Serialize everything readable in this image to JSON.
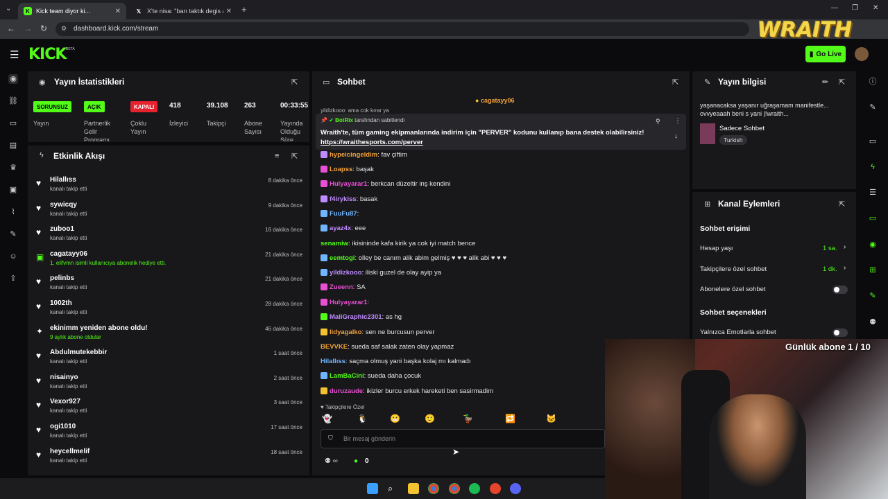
{
  "browser": {
    "tabs": [
      {
        "title": "Kick team diyor ki...",
        "active": true
      },
      {
        "title": "X'te nisa: \"barı taktık degis amk...",
        "active": false
      }
    ],
    "url": "dashboard.kick.com/stream"
  },
  "header": {
    "logo": "KICK",
    "beta": "BETA",
    "go_live": "Go Live",
    "overlay_logo": "WRAITH"
  },
  "stats": {
    "title": "Yayın İstatistikleri",
    "badges": [
      {
        "label": "SORUNSUZ",
        "caption": "Yayın",
        "color": "#53fc18"
      },
      {
        "label": "AÇIK",
        "caption": "Partnerlik Gelir Programı",
        "color": "#53fc18"
      },
      {
        "label": "KAPALI",
        "caption": "Çoklu Yayın",
        "color": "#e5222d"
      }
    ],
    "values": [
      {
        "value": "418",
        "caption": "İzleyici"
      },
      {
        "value": "39.108",
        "caption": "Takipçi"
      },
      {
        "value": "263",
        "caption": "Abone Sayısı"
      },
      {
        "value": "00:33:55",
        "caption": "Yayında Olduğu Süre"
      }
    ]
  },
  "activity": {
    "title": "Etkinlik Akışı",
    "items": [
      {
        "name": "Hilallıss",
        "sub": "kanalı takip etti",
        "time": "8 dakika önce"
      },
      {
        "name": "sywicqy",
        "sub": "kanalı takip etti",
        "time": "9 dakika önce"
      },
      {
        "name": "zuboo1",
        "sub": "kanalı takip etti",
        "time": "16 dakika önce"
      },
      {
        "name": "cagatayy06",
        "sub": "1, elifvmn isimli kullanıcıya abonelik hediye etti.",
        "time": "21 dakika önce"
      },
      {
        "name": "pelinbs",
        "sub": "kanalı takip etti",
        "time": "21 dakika önce"
      },
      {
        "name": "1002th",
        "sub": "kanalı takip etti",
        "time": "28 dakika önce"
      },
      {
        "name": "ekinimm yeniden abone oldu!",
        "sub": "9 aylık abone oldular",
        "time": "46 dakika önce"
      },
      {
        "name": "Abdulmutekebbir",
        "sub": "kanalı takip etti",
        "time": "1 saat önce"
      },
      {
        "name": "nisainyo",
        "sub": "kanalı takip etti",
        "time": "2 saat önce"
      },
      {
        "name": "Vexor927",
        "sub": "kanalı takip etti",
        "time": "3 saat önce"
      },
      {
        "name": "ogi1010",
        "sub": "kanalı takip etti",
        "time": "17 saat önce"
      },
      {
        "name": "heycellmelif",
        "sub": "kanalı takip etti",
        "time": "18 saat önce"
      }
    ]
  },
  "chat": {
    "title": "Sohbet",
    "top_user": "cagatayy06",
    "partial_line": "yildizkooo: ama cok kırar ya",
    "pinned": {
      "by": "BotRix",
      "by_suffix": "tarafından sabitlendi",
      "text": "Wraith'te, tüm gaming ekipmanlarında indirim için \"PERVER\" kodunu kullanıp bana destek olabilirsiniz!",
      "link": "https://wraithesports.com/perver"
    },
    "messages": [
      {
        "user": "hypeicingeldim",
        "color": "#f2a13a",
        "text": "fav çiftim"
      },
      {
        "user": "Loapss",
        "color": "#f2a13a",
        "text": "başak"
      },
      {
        "user": "Hulyayarar1",
        "color": "#e84fd1",
        "text": "berkcan düzeltir inş kendini"
      },
      {
        "user": "f4irykiss",
        "color": "#c08bff",
        "text": "basak"
      },
      {
        "user": "FuuFu87",
        "color": "#6fb6ff",
        "text": ""
      },
      {
        "user": "ayaz4x",
        "color": "#c08bff",
        "text": "eee"
      },
      {
        "user": "senamiw",
        "color": "#53fc18",
        "text": "ikisininde kafa kirik ya cok iyi match bence"
      },
      {
        "user": "eemtogi",
        "color": "#53fc18",
        "text": "olley be canım alik abim gelmiş ♥ ♥ ♥ alik abi ♥ ♥ ♥"
      },
      {
        "user": "yildizkooo",
        "color": "#c08bff",
        "text": "iliski guzel de olay ayip ya"
      },
      {
        "user": "Zueenn",
        "color": "#e84fd1",
        "text": "SA"
      },
      {
        "user": "Hulyayarar1",
        "color": "#e84fd1",
        "text": ""
      },
      {
        "user": "MaliGraphic2301",
        "color": "#c08bff",
        "text": "as hg"
      },
      {
        "user": "lidyagalko",
        "color": "#f2a13a",
        "text": "sen ne burcusun perver"
      },
      {
        "user": "BEVVKE",
        "color": "#f2a13a",
        "text": "sueda saf salak zaten olay yapmaz"
      },
      {
        "user": "Hilallıss",
        "color": "#6fb6ff",
        "text": "saçma olmuş yani başka kolaj mı kalmadı"
      },
      {
        "user": "LamBaCini",
        "color": "#53fc18",
        "text": "sueda daha çocuk"
      },
      {
        "user": "duruzaude",
        "color": "#e84fd1",
        "text": "ikizler burcu erkek hareketi ben sasirmadim"
      }
    ],
    "followers_only": "Takipçilere Özel",
    "input_placeholder": "Bir mesaj gönderin",
    "bottom_count": "0"
  },
  "stream_info": {
    "title": "Yayın bilgisi",
    "description": "yaşanacaksa yaşanır uğraşamam manifestle... ovvyeaaah beni s yani |!wraith...",
    "category": "Sadece Sohbet",
    "language": "Turkish"
  },
  "channel_actions": {
    "title": "Kanal Eylemleri",
    "chat_access": "Sohbet erişimi",
    "rows": [
      {
        "label": "Hesap yaşı",
        "value": "1 sa."
      },
      {
        "label": "Takipçilere özel sohbet",
        "value": "1 dk."
      },
      {
        "label": "Abonelere özel sohbet",
        "value": ""
      }
    ],
    "chat_options": "Sohbet seçenekleri",
    "emote_only": "Yalnızca Emotlarla sohbet"
  },
  "overlay": {
    "sub_goal": "Günlük abone 1 / 10"
  }
}
